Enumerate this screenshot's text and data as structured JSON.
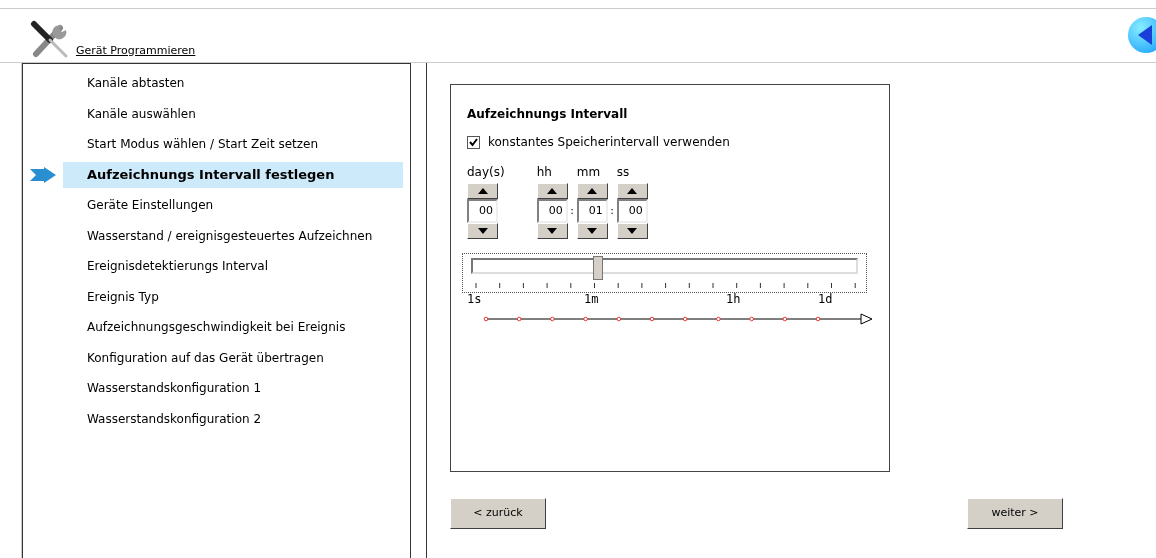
{
  "header": {
    "title": "Gerät Programmieren"
  },
  "steps": [
    {
      "label": "Kanäle abtasten",
      "selected": false
    },
    {
      "label": "Kanäle auswählen",
      "selected": false
    },
    {
      "label": "Start Modus wählen / Start Zeit setzen",
      "selected": false
    },
    {
      "label": "Aufzeichnungs Intervall festlegen",
      "selected": true
    },
    {
      "label": "Geräte Einstellungen",
      "selected": false
    },
    {
      "label": "Wasserstand / ereignisgesteuertes Aufzeichnen",
      "selected": false
    },
    {
      "label": "Ereignisdetektierungs Interval",
      "selected": false
    },
    {
      "label": "Ereignis Typ",
      "selected": false
    },
    {
      "label": "Aufzeichnungsgeschwindigkeit bei Ereignis",
      "selected": false
    },
    {
      "label": "Konfiguration auf das Gerät übertragen",
      "selected": false
    },
    {
      "label": "Wasserstandskonfiguration 1",
      "selected": false
    },
    {
      "label": "Wasserstandskonfiguration 2",
      "selected": false
    }
  ],
  "panel": {
    "title": "Aufzeichnungs Intervall",
    "checkbox": {
      "label": "konstantes Speicherintervall verwenden",
      "checked": true
    },
    "spinners": [
      {
        "label": "day(s)",
        "value": "00"
      },
      {
        "label": "hh",
        "value": "00",
        "separator": ":"
      },
      {
        "label": "mm",
        "value": "01",
        "separator": ":"
      },
      {
        "label": "ss",
        "value": "00"
      }
    ],
    "slider": {
      "level": 0.32,
      "labels": [
        "1s",
        "1m",
        "1h",
        "1d"
      ]
    }
  },
  "buttons": {
    "back": "< zurück",
    "next": "weiter >"
  }
}
